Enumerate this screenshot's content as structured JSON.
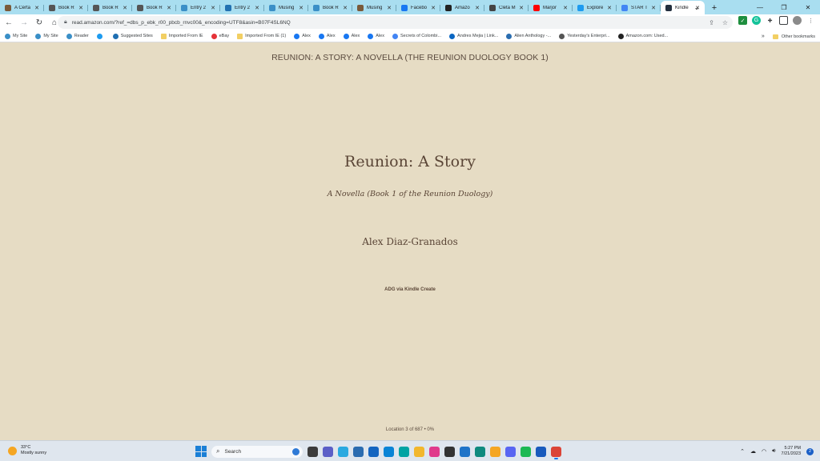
{
  "tabs": [
    {
      "title": "A Certa",
      "icon": "book-icon",
      "color": "#7a5a3a"
    },
    {
      "title": "Book R",
      "icon": "book-icon",
      "color": "#555555"
    },
    {
      "title": "Book R",
      "icon": "book-icon",
      "color": "#555555"
    },
    {
      "title": "Book R",
      "icon": "book-icon",
      "color": "#555555"
    },
    {
      "title": "Entry 2",
      "icon": "wordpress-icon",
      "color": "#3a8fc7"
    },
    {
      "title": "Entry 2",
      "icon": "wordpress-icon",
      "color": "#2271b1"
    },
    {
      "title": "Musing",
      "icon": "wordpress-icon",
      "color": "#3a8fc7"
    },
    {
      "title": "Book R",
      "icon": "wordpress-icon",
      "color": "#3a8fc7"
    },
    {
      "title": "Musing",
      "icon": "book-icon",
      "color": "#7a5a3a"
    },
    {
      "title": "Facebo",
      "icon": "facebook-icon",
      "color": "#1877f2"
    },
    {
      "title": "Amazo",
      "icon": "amazon-icon",
      "color": "#222222"
    },
    {
      "title": "Cleta M",
      "icon": "wikipedia-icon",
      "color": "#444444"
    },
    {
      "title": "Marjor",
      "icon": "youtube-icon",
      "color": "#ff0000"
    },
    {
      "title": "Explore",
      "icon": "twitter-icon",
      "color": "#1d9bf0"
    },
    {
      "title": "STAR T",
      "icon": "google-icon",
      "color": "#4285f4"
    },
    {
      "title": "Kindle",
      "icon": "kindle-icon",
      "color": "#232f3e",
      "active": true
    }
  ],
  "toolbar": {
    "url": "read.amazon.com/?ref_=dbs_p_ebk_r00_pbcb_rnvc00&_encoding=UTF8&asin=B07F4SL6NQ"
  },
  "bookmarks": [
    {
      "label": "My Site",
      "icon": "wordpress-icon",
      "color": "#3a8fc7"
    },
    {
      "label": "My Site",
      "icon": "wordpress-icon",
      "color": "#3a8fc7"
    },
    {
      "label": "Reader",
      "icon": "wordpress-icon",
      "color": "#3a8fc7"
    },
    {
      "label": "",
      "icon": "twitter-icon",
      "color": "#1d9bf0"
    },
    {
      "label": "Suggested Sites",
      "icon": "ie-icon",
      "color": "#1f6fb2"
    },
    {
      "label": "Imported From IE",
      "icon": "folder-icon",
      "color": "#f2cf63"
    },
    {
      "label": "eBay",
      "icon": "ebay-icon",
      "color": "#e53238"
    },
    {
      "label": "Imported From IE (1)",
      "icon": "folder-icon",
      "color": "#f2cf63"
    },
    {
      "label": "Alex",
      "icon": "facebook-icon",
      "color": "#1877f2"
    },
    {
      "label": "Alex",
      "icon": "facebook-icon",
      "color": "#1877f2"
    },
    {
      "label": "Alex",
      "icon": "facebook-icon",
      "color": "#1877f2"
    },
    {
      "label": "Alex",
      "icon": "facebook-icon",
      "color": "#1877f2"
    },
    {
      "label": "Secrets of Colombi...",
      "icon": "google-icon",
      "color": "#4285f4"
    },
    {
      "label": "Andres Mejia | Link...",
      "icon": "linkedin-icon",
      "color": "#0a66c2"
    },
    {
      "label": "Alien Anthology -...",
      "icon": "site-icon",
      "color": "#2a6db0"
    },
    {
      "label": "Yesterday's Enterpri...",
      "icon": "site-icon",
      "color": "#555555"
    },
    {
      "label": "Amazon.com: Used...",
      "icon": "amazon-icon",
      "color": "#222222"
    }
  ],
  "bookmarks_more": "»",
  "other_bookmarks": "Other bookmarks",
  "reader": {
    "header": "REUNION: A STORY: A NOVELLA (THE REUNION DUOLOGY BOOK 1)",
    "title": "Reunion: A Story",
    "subtitle": "A Novella (Book 1 of the Reunion Duology)",
    "author": "Alex Diaz-Granados",
    "publisher": "ADG via Kindle Create",
    "location": "Location 3 of 687  •  0%"
  },
  "taskbar": {
    "weather_temp": "33°C",
    "weather_desc": "Mostly sunny",
    "search_placeholder": "Search",
    "time": "5:27 PM",
    "date": "7/21/2023",
    "notification_count": "2",
    "apps": [
      {
        "icon": "file-explorer-icon",
        "color": "#3b3b3b"
      },
      {
        "icon": "teams-icon",
        "color": "#5b5fc7"
      },
      {
        "icon": "l-app-icon",
        "color": "#2aa9e0"
      },
      {
        "icon": "store-icon",
        "color": "#2b6cb0"
      },
      {
        "icon": "calendar-icon",
        "color": "#1565c0"
      },
      {
        "icon": "app-blue-icon",
        "color": "#0a84d6"
      },
      {
        "icon": "tv-icon",
        "color": "#00a3a3"
      },
      {
        "icon": "folder-icon",
        "color": "#f2b72e"
      },
      {
        "icon": "photos-icon",
        "color": "#e03a8c"
      },
      {
        "icon": "game-icon",
        "color": "#333333"
      },
      {
        "icon": "k-app-icon",
        "color": "#1e73c8"
      },
      {
        "icon": "edge-icon",
        "color": "#0f8a7e"
      },
      {
        "icon": "chrome-canary-icon",
        "color": "#f5a623"
      },
      {
        "icon": "discord-icon",
        "color": "#5865f2"
      },
      {
        "icon": "spotify-icon",
        "color": "#1db954"
      },
      {
        "icon": "word-icon",
        "color": "#185abd"
      },
      {
        "icon": "chrome-icon",
        "color": "#db4437",
        "active": true
      }
    ]
  }
}
